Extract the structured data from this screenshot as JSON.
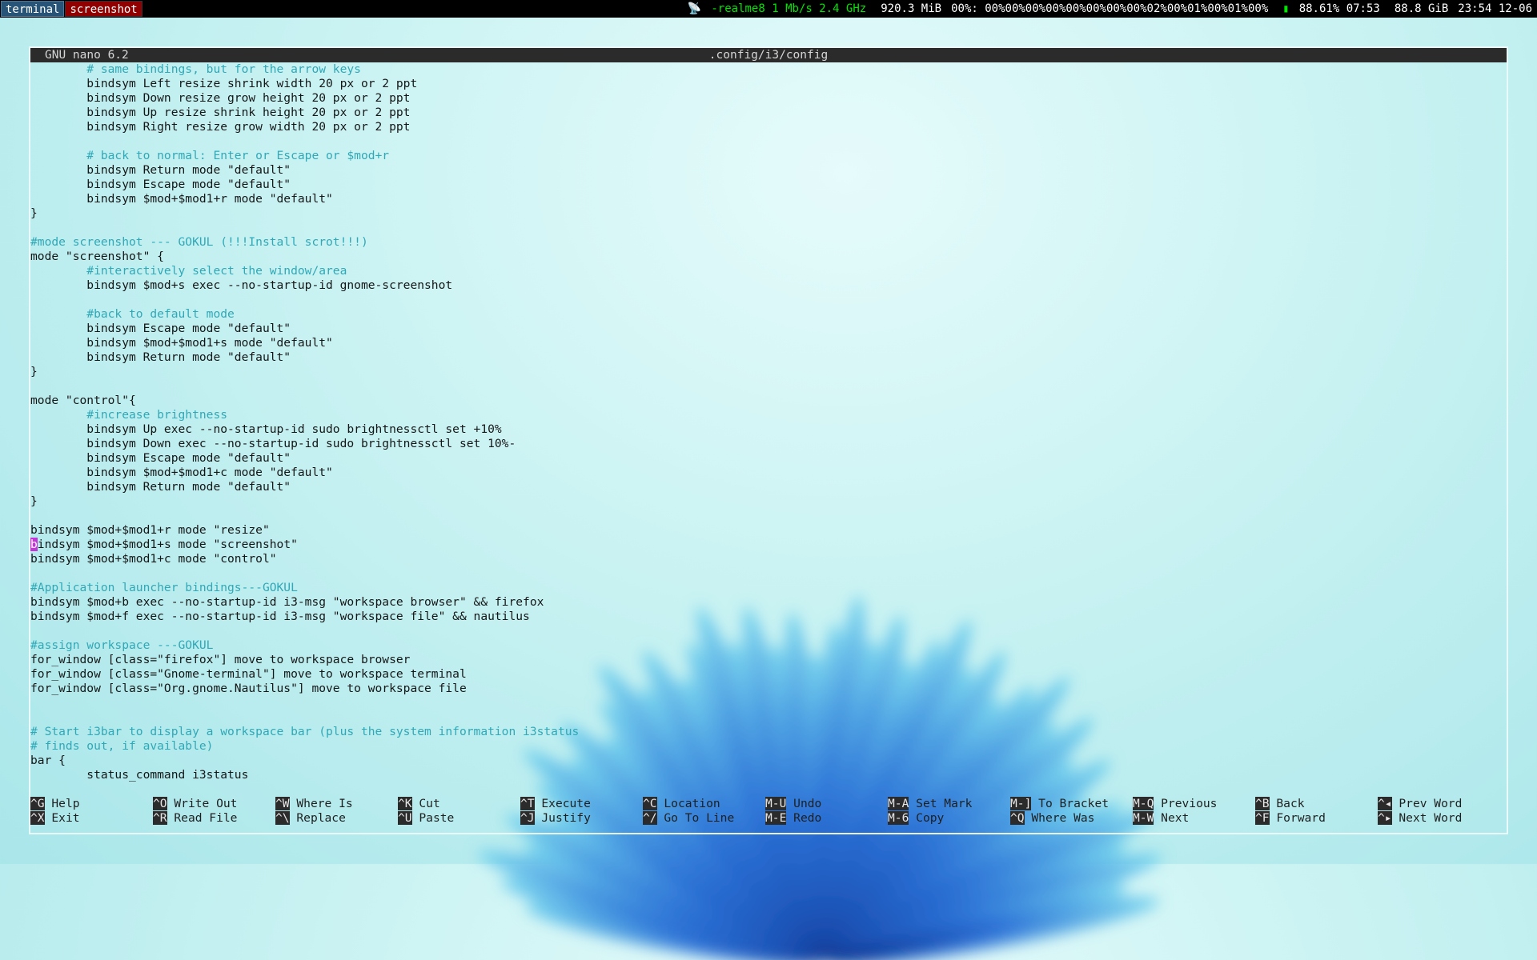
{
  "topbar": {
    "workspaces": [
      {
        "label": "terminal",
        "state": "focused"
      },
      {
        "label": "screenshot",
        "state": "urgent"
      }
    ],
    "status": {
      "wifi": "-realme8 1 Mb/s 2.4 GHz",
      "memory": "920.3 MiB",
      "cpu": "00%: 00%00%00%00%00%00%00%00%02%00%01%00%01%00%",
      "battery": "88.61% 07:53",
      "disk": "88.8 GiB",
      "clock": "23:54 12-06"
    }
  },
  "nano": {
    "version": "GNU nano 6.2",
    "filename": ".config/i3/config",
    "cursor_char": "b",
    "lines": [
      {
        "text": "        # same bindings, but for the arrow keys",
        "type": "comment"
      },
      {
        "text": "        bindsym Left resize shrink width 20 px or 2 ppt",
        "type": "code"
      },
      {
        "text": "        bindsym Down resize grow height 20 px or 2 ppt",
        "type": "code"
      },
      {
        "text": "        bindsym Up resize shrink height 20 px or 2 ppt",
        "type": "code"
      },
      {
        "text": "        bindsym Right resize grow width 20 px or 2 ppt",
        "type": "code"
      },
      {
        "text": "",
        "type": "code"
      },
      {
        "text": "        # back to normal: Enter or Escape or $mod+r",
        "type": "comment"
      },
      {
        "text": "        bindsym Return mode \"default\"",
        "type": "code"
      },
      {
        "text": "        bindsym Escape mode \"default\"",
        "type": "code"
      },
      {
        "text": "        bindsym $mod+$mod1+r mode \"default\"",
        "type": "code"
      },
      {
        "text": "}",
        "type": "code"
      },
      {
        "text": "",
        "type": "code"
      },
      {
        "text": "#mode screenshot --- GOKUL (!!!Install scrot!!!)",
        "type": "comment"
      },
      {
        "text": "mode \"screenshot\" {",
        "type": "code"
      },
      {
        "text": "        #interactively select the window/area",
        "type": "comment"
      },
      {
        "text": "        bindsym $mod+s exec --no-startup-id gnome-screenshot",
        "type": "code"
      },
      {
        "text": "",
        "type": "code"
      },
      {
        "text": "        #back to default mode",
        "type": "comment"
      },
      {
        "text": "        bindsym Escape mode \"default\"",
        "type": "code"
      },
      {
        "text": "        bindsym $mod+$mod1+s mode \"default\"",
        "type": "code"
      },
      {
        "text": "        bindsym Return mode \"default\"",
        "type": "code"
      },
      {
        "text": "}",
        "type": "code"
      },
      {
        "text": "",
        "type": "code"
      },
      {
        "text": "mode \"control\"{",
        "type": "code"
      },
      {
        "text": "        #increase brightness",
        "type": "comment"
      },
      {
        "text": "        bindsym Up exec --no-startup-id sudo brightnessctl set +10%",
        "type": "code"
      },
      {
        "text": "        bindsym Down exec --no-startup-id sudo brightnessctl set 10%-",
        "type": "code"
      },
      {
        "text": "        bindsym Escape mode \"default\"",
        "type": "code"
      },
      {
        "text": "        bindsym $mod+$mod1+c mode \"default\"",
        "type": "code"
      },
      {
        "text": "        bindsym Return mode \"default\"",
        "type": "code"
      },
      {
        "text": "}",
        "type": "code"
      },
      {
        "text": "",
        "type": "code"
      },
      {
        "text": "bindsym $mod+$mod1+r mode \"resize\"",
        "type": "code"
      },
      {
        "text": "indsym $mod+$mod1+s mode \"screenshot\"",
        "type": "cursor"
      },
      {
        "text": "bindsym $mod+$mod1+c mode \"control\"",
        "type": "code"
      },
      {
        "text": "",
        "type": "code"
      },
      {
        "text": "#Application launcher bindings---GOKUL",
        "type": "comment"
      },
      {
        "text": "bindsym $mod+b exec --no-startup-id i3-msg \"workspace browser\" && firefox",
        "type": "code"
      },
      {
        "text": "bindsym $mod+f exec --no-startup-id i3-msg \"workspace file\" && nautilus",
        "type": "code"
      },
      {
        "text": "",
        "type": "code"
      },
      {
        "text": "#assign workspace ---GOKUL",
        "type": "comment"
      },
      {
        "text": "for_window [class=\"firefox\"] move to workspace browser",
        "type": "code"
      },
      {
        "text": "for_window [class=\"Gnome-terminal\"] move to workspace terminal",
        "type": "code"
      },
      {
        "text": "for_window [class=\"Org.gnome.Nautilus\"] move to workspace file",
        "type": "code"
      },
      {
        "text": "",
        "type": "code"
      },
      {
        "text": "",
        "type": "code"
      },
      {
        "text": "# Start i3bar to display a workspace bar (plus the system information i3status",
        "type": "comment"
      },
      {
        "text": "# finds out, if available)",
        "type": "comment"
      },
      {
        "text": "bar {",
        "type": "code"
      },
      {
        "text": "        status_command i3status",
        "type": "code"
      }
    ],
    "shortcuts": [
      {
        "key": "^G",
        "label": "Help",
        "key2": "^X",
        "label2": "Exit"
      },
      {
        "key": "^O",
        "label": "Write Out",
        "key2": "^R",
        "label2": "Read File"
      },
      {
        "key": "^W",
        "label": "Where Is",
        "key2": "^\\",
        "label2": "Replace"
      },
      {
        "key": "^K",
        "label": "Cut",
        "key2": "^U",
        "label2": "Paste"
      },
      {
        "key": "^T",
        "label": "Execute",
        "key2": "^J",
        "label2": "Justify"
      },
      {
        "key": "^C",
        "label": "Location",
        "key2": "^/",
        "label2": "Go To Line"
      },
      {
        "key": "M-U",
        "label": "Undo",
        "key2": "M-E",
        "label2": "Redo"
      },
      {
        "key": "M-A",
        "label": "Set Mark",
        "key2": "M-6",
        "label2": "Copy"
      },
      {
        "key": "M-]",
        "label": "To Bracket",
        "key2": "^Q",
        "label2": "Where Was"
      },
      {
        "key": "M-Q",
        "label": "Previous",
        "key2": "M-W",
        "label2": "Next"
      },
      {
        "key": "^B",
        "label": "Back",
        "key2": "^F",
        "label2": "Forward"
      },
      {
        "key": "^◂",
        "label": "Prev Word",
        "key2": "^▸",
        "label2": "Next Word"
      }
    ]
  },
  "colors": {
    "comment": "#2fa8b7",
    "cursor": "#c235d6",
    "focused_workspace": "#285577",
    "urgent_workspace": "#900000",
    "wifi": "#00e600"
  }
}
